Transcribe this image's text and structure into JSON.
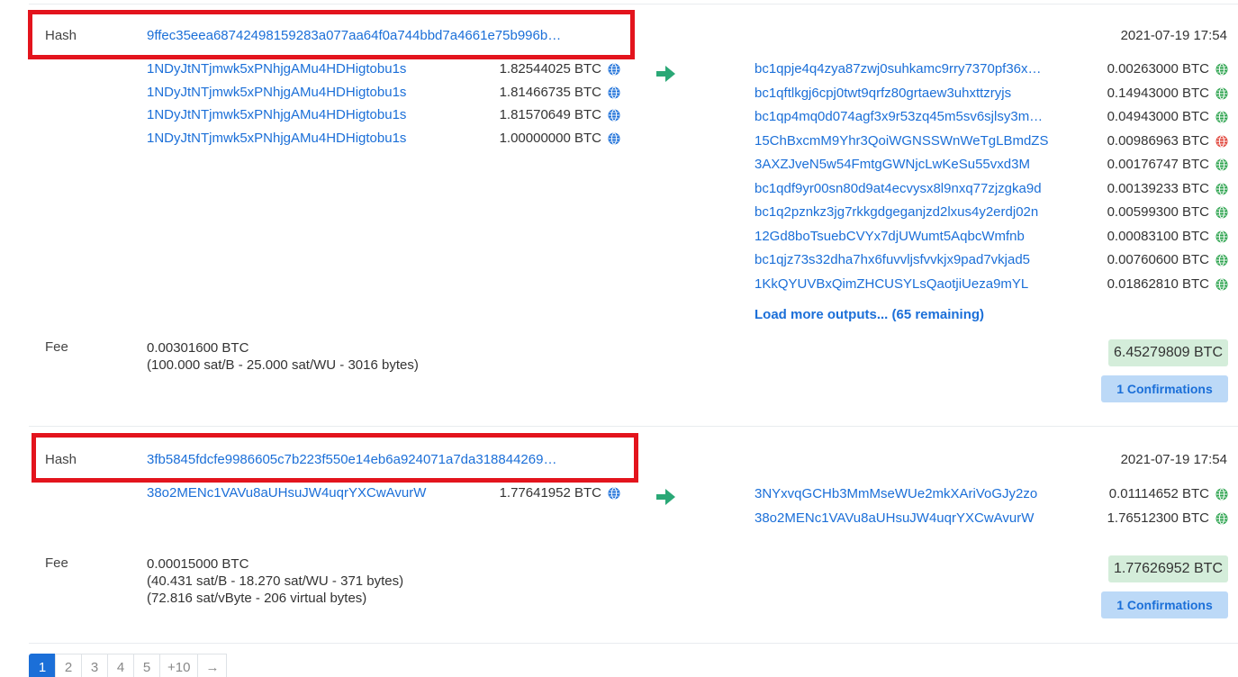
{
  "transactions": [
    {
      "hash_label": "Hash",
      "hash": "9ffec35eea68742498159283a077aa64f0a744bbd7a4661e75b996b…",
      "date": "2021-07-19 17:54",
      "inputs": [
        {
          "address": "1NDyJtNTjmwk5xPNhjgAMu4HDHigtobu1s",
          "amount": "1.82544025 BTC"
        },
        {
          "address": "1NDyJtNTjmwk5xPNhjgAMu4HDHigtobu1s",
          "amount": "1.81466735 BTC"
        },
        {
          "address": "1NDyJtNTjmwk5xPNhjgAMu4HDHigtobu1s",
          "amount": "1.81570649 BTC"
        },
        {
          "address": "1NDyJtNTjmwk5xPNhjgAMu4HDHigtobu1s",
          "amount": "1.00000000 BTC"
        }
      ],
      "outputs": [
        {
          "address": "bc1qpje4q4zya87zwj0suhkamc9rry7370pf36x…",
          "amount": "0.00263000 BTC",
          "status": "unspent"
        },
        {
          "address": "bc1qftlkgj6cpj0twt9qrfz80grtaew3uhxttzryjs",
          "amount": "0.14943000 BTC",
          "status": "unspent"
        },
        {
          "address": "bc1qp4mq0d074agf3x9r53zq45m5sv6sjlsy3m…",
          "amount": "0.04943000 BTC",
          "status": "unspent"
        },
        {
          "address": "15ChBxcmM9Yhr3QoiWGNSSWnWeTgLBmdZS",
          "amount": "0.00986963 BTC",
          "status": "spent"
        },
        {
          "address": "3AXZJveN5w54FmtgGWNjcLwKeSu55vxd3M",
          "amount": "0.00176747 BTC",
          "status": "unspent"
        },
        {
          "address": "bc1qdf9yr00sn80d9at4ecvysx8l9nxq77zjzgka9d",
          "amount": "0.00139233 BTC",
          "status": "unspent"
        },
        {
          "address": "bc1q2pznkz3jg7rkkgdgeganjzd2lxus4y2erdj02n",
          "amount": "0.00599300 BTC",
          "status": "unspent"
        },
        {
          "address": "12Gd8boTsuebCVYx7djUWumt5AqbcWmfnb",
          "amount": "0.00083100 BTC",
          "status": "unspent"
        },
        {
          "address": "bc1qjz73s32dha7hx6fuvvljsfvvkjx9pad7vkjad5",
          "amount": "0.00760600 BTC",
          "status": "unspent"
        },
        {
          "address": "1KkQYUVBxQimZHCUSYLsQaotjiUeza9mYL",
          "amount": "0.01862810 BTC",
          "status": "unspent"
        }
      ],
      "load_more": "Load more outputs... (65 remaining)",
      "fee_label": "Fee",
      "fee_lines": [
        "0.00301600 BTC",
        "(100.000 sat/B - 25.000 sat/WU - 3016 bytes)"
      ],
      "total": "6.45279809 BTC",
      "confirmations": "1 Confirmations"
    },
    {
      "hash_label": "Hash",
      "hash": "3fb5845fdcfe9986605c7b223f550e14eb6a924071a7da318844269…",
      "date": "2021-07-19 17:54",
      "inputs": [
        {
          "address": "38o2MENc1VAVu8aUHsuJW4uqrYXCwAvurW",
          "amount": "1.77641952 BTC"
        }
      ],
      "outputs": [
        {
          "address": "3NYxvqGCHb3MmMseWUe2mkXAriVoGJy2zo",
          "amount": "0.01114652 BTC",
          "status": "unspent"
        },
        {
          "address": "38o2MENc1VAVu8aUHsuJW4uqrYXCwAvurW",
          "amount": "1.76512300 BTC",
          "status": "unspent"
        }
      ],
      "fee_label": "Fee",
      "fee_lines": [
        "0.00015000 BTC",
        "(40.431 sat/B - 18.270 sat/WU - 371 bytes)",
        "(72.816 sat/vByte - 206 virtual bytes)"
      ],
      "total": "1.77626952 BTC",
      "confirmations": "1 Confirmations"
    }
  ],
  "pagination": {
    "pages": [
      "1",
      "2",
      "3",
      "4",
      "5",
      "+10",
      "→"
    ],
    "active": "1"
  },
  "colors": {
    "link": "#1b6fd8",
    "unspent": "#2ea44f",
    "spent": "#e0443a",
    "highlight_border": "#e3141d",
    "arrow": "#2aa876"
  },
  "icons": {
    "input_status": "globe-icon-blue",
    "output_unspent": "globe-icon-green",
    "output_spent": "globe-icon-red",
    "direction": "arrow-right-icon"
  }
}
